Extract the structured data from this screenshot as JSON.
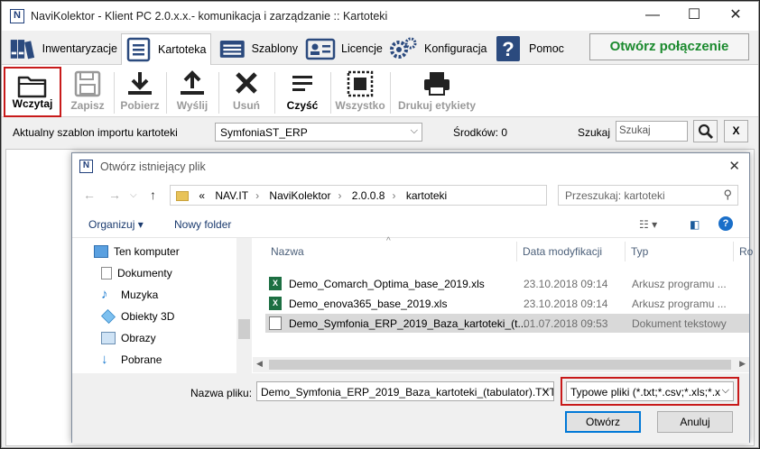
{
  "window": {
    "title": "NaviKolektor - Klient PC 2.0.x.x.- komunikacja i zarządzanie :: Kartoteki",
    "app_icon": "N",
    "minimize": "—",
    "maximize": "☐",
    "close": "✕"
  },
  "tabs": [
    {
      "label": "Inwentaryzacje",
      "icon": "binders-icon"
    },
    {
      "label": "Kartoteka",
      "icon": "card-icon",
      "active": true
    },
    {
      "label": "Szablony",
      "icon": "template-icon"
    },
    {
      "label": "Licencje",
      "icon": "license-icon"
    },
    {
      "label": "Konfiguracja",
      "icon": "gears-icon"
    },
    {
      "label": "Pomoc",
      "icon": "help-icon"
    }
  ],
  "connect_button": "Otwórz połączenie",
  "toolbar": {
    "load": "Wczytaj",
    "save": "Zapisz",
    "download": "Pobierz",
    "send": "Wyślij",
    "delete": "Usuń",
    "clear": "Czyść",
    "all": "Wszystko",
    "print_labels": "Drukuj etykiety"
  },
  "infobar": {
    "template_label": "Aktualny szablon importu kartoteki",
    "template_value": "SymfoniaST_ERP",
    "assets_label": "Środków: 0",
    "search_label": "Szukaj",
    "search_placeholder": "Szukaj",
    "clear_button": "X"
  },
  "dialog": {
    "title": "Otwórz istniejący plik",
    "app_icon": "N",
    "close": "✕",
    "breadcrumb_prefix": "«",
    "breadcrumb": [
      "NAV.IT",
      "NaviKolektor",
      "2.0.0.8",
      "kartoteki"
    ],
    "search_placeholder": "Przeszukaj: kartoteki",
    "organize": "Organizuj ▾",
    "new_folder": "Nowy folder",
    "tree": [
      {
        "label": "Ten komputer",
        "icon": "computer-icon"
      },
      {
        "label": "Dokumenty",
        "icon": "documents-icon"
      },
      {
        "label": "Muzyka",
        "icon": "music-icon"
      },
      {
        "label": "Obiekty 3D",
        "icon": "cube-icon"
      },
      {
        "label": "Obrazy",
        "icon": "pictures-icon"
      },
      {
        "label": "Pobrane",
        "icon": "download-icon"
      }
    ],
    "columns": {
      "name": "Nazwa",
      "date": "Data modyfikacji",
      "type": "Typ",
      "size": "Ro"
    },
    "files": [
      {
        "name": "Demo_Comarch_Optima_base_2019.xls",
        "date": "23.10.2018 09:14",
        "type": "Arkusz programu ...",
        "icon": "excel-icon"
      },
      {
        "name": "Demo_enova365_base_2019.xls",
        "date": "23.10.2018 09:14",
        "type": "Arkusz programu ...",
        "icon": "excel-icon"
      },
      {
        "name": "Demo_Symfonia_ERP_2019_Baza_kartoteki_(t...",
        "date": "01.07.2018 09:53",
        "type": "Dokument tekstowy",
        "icon": "text-file-icon",
        "selected": true
      }
    ],
    "filename_label": "Nazwa pliku:",
    "filename_value": "Demo_Symfonia_ERP_2019_Baza_kartoteki_(tabulator).TXT",
    "filetype_value": "Typowe pliki (*.txt;*.csv;*.xls;*.xl",
    "open_button": "Otwórz",
    "cancel_button": "Anuluj"
  }
}
